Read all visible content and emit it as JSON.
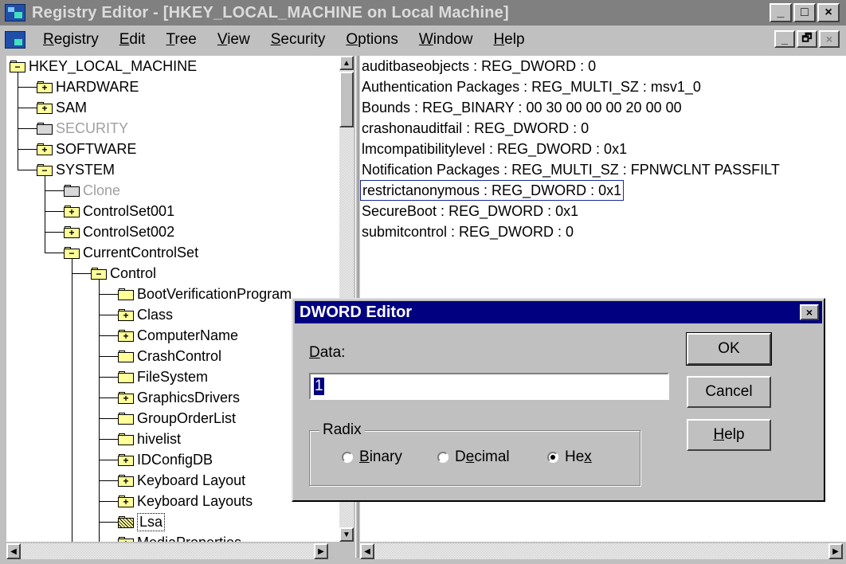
{
  "window": {
    "title": "Registry Editor - [HKEY_LOCAL_MACHINE on Local Machine]",
    "buttons": [
      "_",
      "□",
      "×"
    ],
    "mdi_buttons": [
      "_",
      "🗗",
      "×"
    ]
  },
  "menu": [
    {
      "pre": "",
      "key": "R",
      "post": "egistry"
    },
    {
      "pre": "",
      "key": "E",
      "post": "dit"
    },
    {
      "pre": "",
      "key": "T",
      "post": "ree"
    },
    {
      "pre": "",
      "key": "V",
      "post": "iew"
    },
    {
      "pre": "",
      "key": "S",
      "post": "ecurity"
    },
    {
      "pre": "",
      "key": "O",
      "post": "ptions"
    },
    {
      "pre": "",
      "key": "W",
      "post": "indow"
    },
    {
      "pre": "",
      "key": "H",
      "post": "elp"
    }
  ],
  "tree": [
    {
      "label": "HKEY_LOCAL_MACHINE",
      "level": 0,
      "state": "open",
      "style": "normal"
    },
    {
      "label": "HARDWARE",
      "level": 1,
      "state": "plus",
      "style": "normal"
    },
    {
      "label": "SAM",
      "level": 1,
      "state": "plus",
      "style": "normal"
    },
    {
      "label": "SECURITY",
      "level": 1,
      "state": "empty",
      "style": "disabled"
    },
    {
      "label": "SOFTWARE",
      "level": 1,
      "state": "plus",
      "style": "normal"
    },
    {
      "label": "SYSTEM",
      "level": 1,
      "state": "open",
      "style": "normal"
    },
    {
      "label": "Clone",
      "level": 2,
      "state": "empty",
      "style": "disabled"
    },
    {
      "label": "ControlSet001",
      "level": 2,
      "state": "plus",
      "style": "normal"
    },
    {
      "label": "ControlSet002",
      "level": 2,
      "state": "plus",
      "style": "normal"
    },
    {
      "label": "CurrentControlSet",
      "level": 2,
      "state": "open",
      "style": "normal"
    },
    {
      "label": "Control",
      "level": 3,
      "state": "open",
      "style": "normal"
    },
    {
      "label": "BootVerificationProgram",
      "level": 4,
      "state": "empty",
      "style": "normal"
    },
    {
      "label": "Class",
      "level": 4,
      "state": "plus",
      "style": "normal"
    },
    {
      "label": "ComputerName",
      "level": 4,
      "state": "plus",
      "style": "normal"
    },
    {
      "label": "CrashControl",
      "level": 4,
      "state": "empty",
      "style": "normal"
    },
    {
      "label": "FileSystem",
      "level": 4,
      "state": "empty",
      "style": "normal"
    },
    {
      "label": "GraphicsDrivers",
      "level": 4,
      "state": "plus",
      "style": "normal"
    },
    {
      "label": "GroupOrderList",
      "level": 4,
      "state": "empty",
      "style": "normal"
    },
    {
      "label": "hivelist",
      "level": 4,
      "state": "empty",
      "style": "normal"
    },
    {
      "label": "IDConfigDB",
      "level": 4,
      "state": "plus",
      "style": "normal"
    },
    {
      "label": "Keyboard Layout",
      "level": 4,
      "state": "plus",
      "style": "normal"
    },
    {
      "label": "Keyboard Layouts",
      "level": 4,
      "state": "plus",
      "style": "normal"
    },
    {
      "label": "Lsa",
      "level": 4,
      "state": "selected",
      "style": "selected"
    },
    {
      "label": "MediaProperties",
      "level": 4,
      "state": "plus",
      "style": "normal"
    }
  ],
  "values": [
    {
      "text": "auditbaseobjects : REG_DWORD : 0",
      "selected": false
    },
    {
      "text": "Authentication Packages : REG_MULTI_SZ : msv1_0",
      "selected": false
    },
    {
      "text": "Bounds : REG_BINARY : 00 30 00 00 00 20 00 00",
      "selected": false
    },
    {
      "text": "crashonauditfail : REG_DWORD : 0",
      "selected": false
    },
    {
      "text": "lmcompatibilitylevel : REG_DWORD : 0x1",
      "selected": false
    },
    {
      "text": "Notification Packages : REG_MULTI_SZ : FPNWCLNT PASSFILT",
      "selected": false
    },
    {
      "text": "restrictanonymous : REG_DWORD : 0x1",
      "selected": true
    },
    {
      "text": "SecureBoot : REG_DWORD : 0x1",
      "selected": false
    },
    {
      "text": "submitcontrol : REG_DWORD : 0",
      "selected": false
    }
  ],
  "dialog": {
    "title": "DWORD Editor",
    "close": "×",
    "data_label_key": "D",
    "data_label_rest": "ata:",
    "data_value": "1",
    "radix_label": "Radix",
    "radios": [
      {
        "key": "B",
        "rest": "inary",
        "pre": "",
        "checked": false
      },
      {
        "key": "e",
        "rest": "cimal",
        "pre": "D",
        "checked": false
      },
      {
        "key": "x",
        "rest": "",
        "pre": "He",
        "checked": true
      }
    ],
    "ok": "OK",
    "cancel": "Cancel",
    "help_key": "H",
    "help_rest": "elp"
  }
}
